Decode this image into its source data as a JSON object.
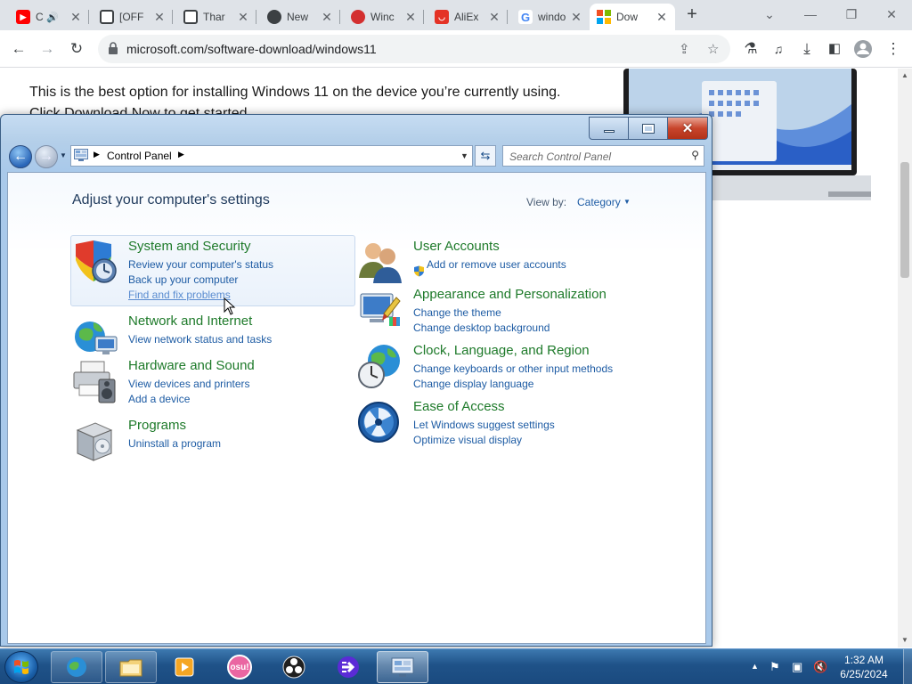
{
  "browser": {
    "tabs": [
      {
        "title": "C",
        "favicon": "youtube-icon",
        "color": "#ff0000",
        "extra": "speaker-icon"
      },
      {
        "title": "[OFF",
        "favicon": "layers-icon",
        "color": "#3c4043"
      },
      {
        "title": "Thar",
        "favicon": "layers-icon",
        "color": "#3c4043"
      },
      {
        "title": "New",
        "favicon": "chrome-icon",
        "color": "#3c4043"
      },
      {
        "title": "Winc",
        "favicon": "red-round-icon",
        "color": "#d32f2f"
      },
      {
        "title": "AliEx",
        "favicon": "aliexpress-icon",
        "color": "#e43225"
      },
      {
        "title": "windo",
        "favicon": "google-icon",
        "color": "#4285f4"
      },
      {
        "title": "Dow",
        "favicon": "microsoft-icon",
        "color": "#f25022"
      }
    ],
    "new_tab": "+",
    "url": "microsoft.com/software-download/windows11"
  },
  "webpage": {
    "intro": "This is the best option for installing Windows 11 on the device you’re currently using.",
    "intro_cut": "Click Download Now to get started."
  },
  "control_panel": {
    "breadcrumb": "Control Panel",
    "search_placeholder": "Search Control Panel",
    "heading": "Adjust your computer's settings",
    "view_by_label": "View by:",
    "view_by_value": "Category",
    "categories_left": [
      {
        "title": "System and Security",
        "icon": "shield-security-icon",
        "links": [
          "Review your computer's status",
          "Back up your computer",
          "Find and fix problems"
        ]
      },
      {
        "title": "Network and Internet",
        "icon": "network-globe-icon",
        "links": [
          "View network status and tasks"
        ]
      },
      {
        "title": "Hardware and Sound",
        "icon": "printer-speaker-icon",
        "links": [
          "View devices and printers",
          "Add a device"
        ]
      },
      {
        "title": "Programs",
        "icon": "programs-box-icon",
        "links": [
          "Uninstall a program"
        ]
      }
    ],
    "categories_right": [
      {
        "title": "User Accounts",
        "icon": "users-icon",
        "links": [
          "Add or remove user accounts"
        ]
      },
      {
        "title": "Appearance and Personalization",
        "icon": "paint-brush-icon",
        "links": [
          "Change the theme",
          "Change desktop background"
        ]
      },
      {
        "title": "Clock, Language, and Region",
        "icon": "clock-globe-icon",
        "links": [
          "Change keyboards or other input methods",
          "Change display language"
        ]
      },
      {
        "title": "Ease of Access",
        "icon": "ease-of-access-icon",
        "links": [
          "Let Windows suggest settings",
          "Optimize visual display"
        ]
      }
    ]
  },
  "taskbar": {
    "items": [
      "ie-icon",
      "explorer-folder-icon",
      "media-player-icon",
      "osu-icon",
      "obs-icon",
      "app-arrow-icon",
      "control-panel-icon"
    ],
    "osu_label": "osu!",
    "time": "1:32 AM",
    "date": "6/25/2024"
  }
}
